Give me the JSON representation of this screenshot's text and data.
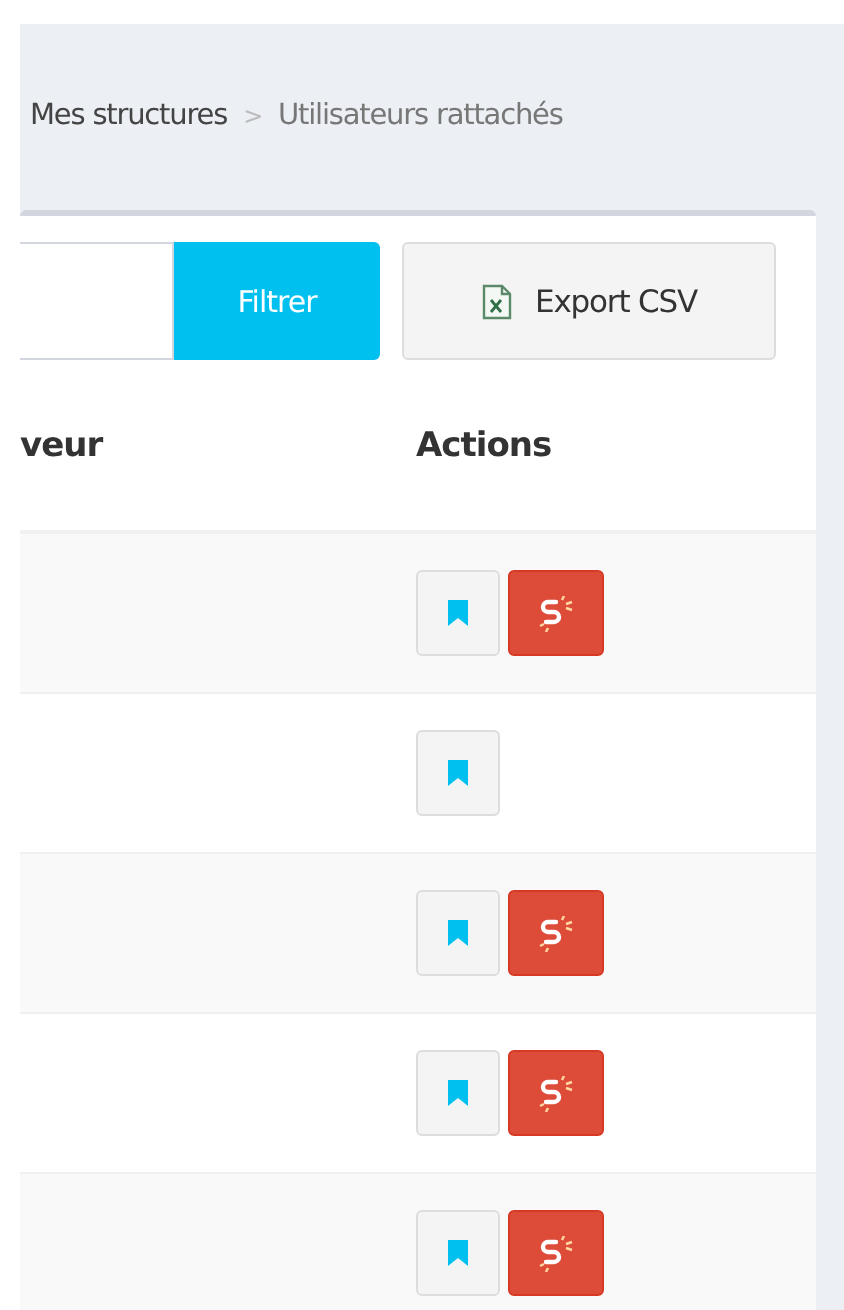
{
  "breadcrumb": [
    {
      "label": "Mes structures",
      "current": false
    },
    {
      "label": "Utilisateurs rattachés",
      "current": true
    }
  ],
  "breadcrumb_separator": ">",
  "toolbar": {
    "filter_button": "Filtrer",
    "export_button": "Export CSV"
  },
  "table": {
    "columns": [
      "veur",
      "Actions"
    ],
    "rows": [
      {
        "can_unlink": true
      },
      {
        "can_unlink": false
      },
      {
        "can_unlink": true
      },
      {
        "can_unlink": true
      },
      {
        "can_unlink": true
      }
    ]
  }
}
